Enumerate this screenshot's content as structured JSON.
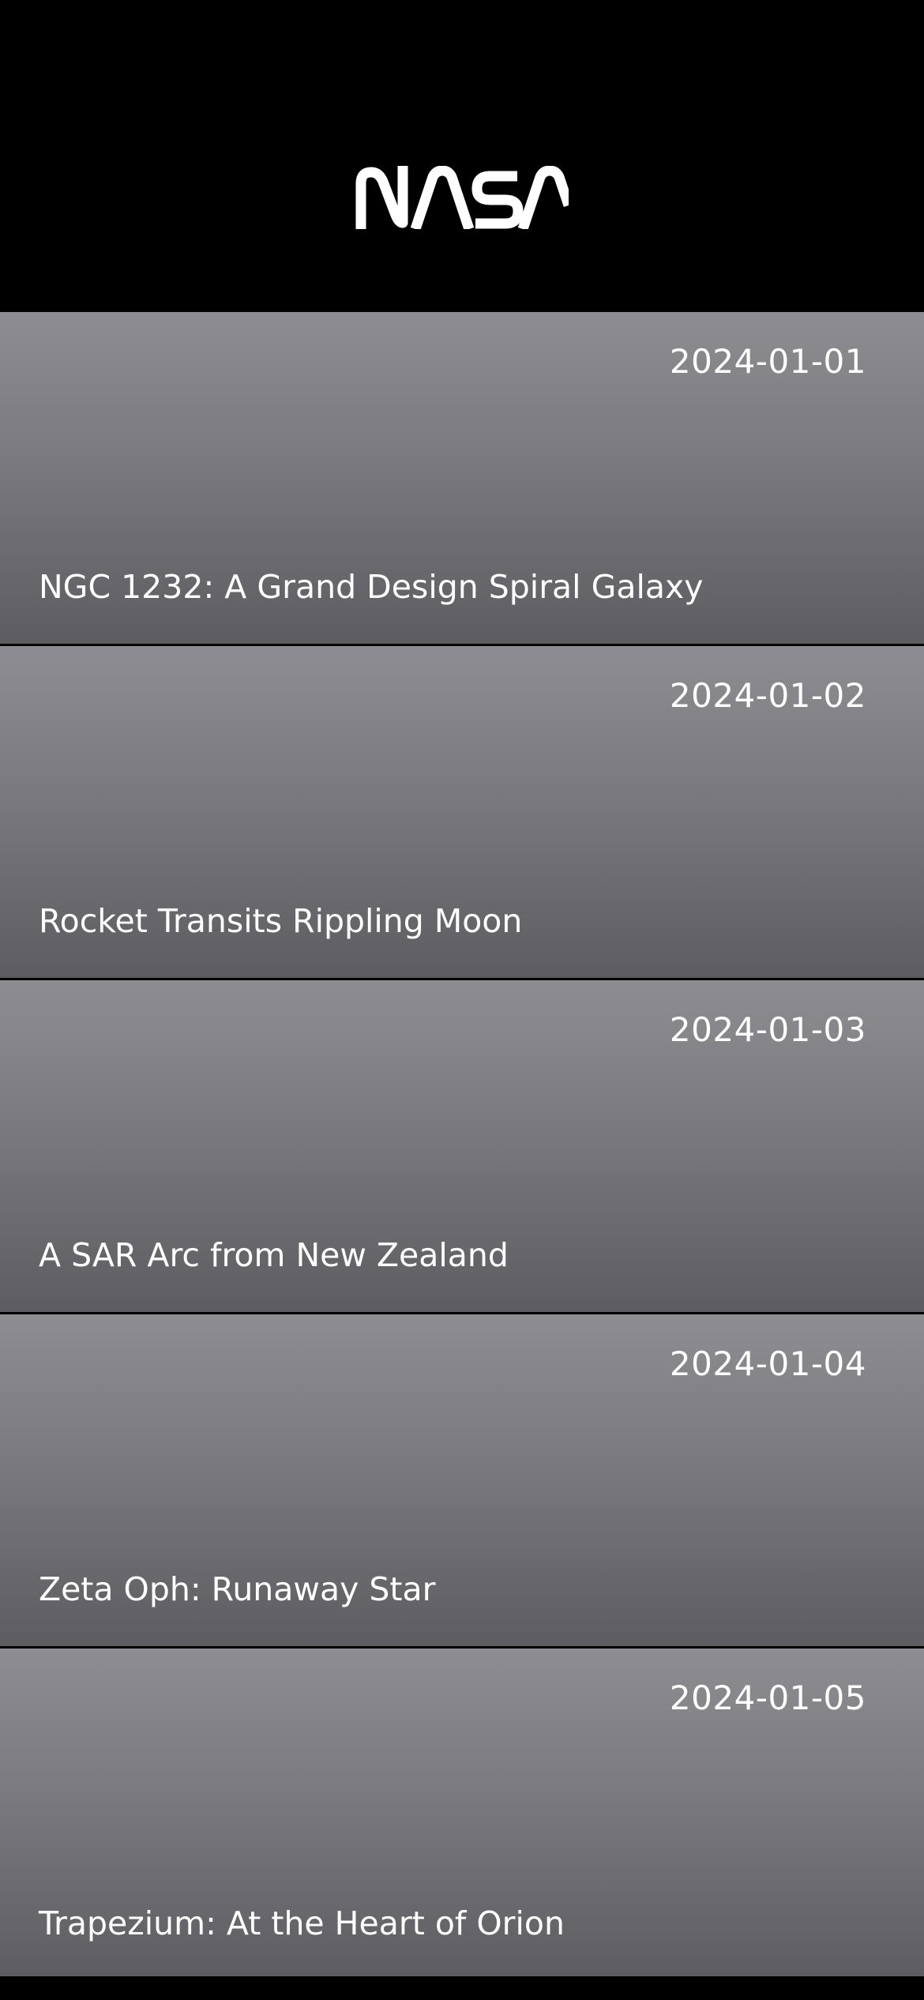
{
  "header": {
    "logo_text": "NASA",
    "logo_icon": "nasa-worm-logo"
  },
  "colors": {
    "background": "#000000",
    "card_top": "#8e8d92",
    "card_bottom": "#5d5d61",
    "text": "#ffffff",
    "divider": "#d4d4d6"
  },
  "items": [
    {
      "date": "2024-01-01",
      "title": "NGC 1232: A Grand Design Spiral Galaxy"
    },
    {
      "date": "2024-01-02",
      "title": "Rocket Transits Rippling Moon"
    },
    {
      "date": "2024-01-03",
      "title": "A SAR Arc from New Zealand"
    },
    {
      "date": "2024-01-04",
      "title": "Zeta Oph: Runaway Star"
    },
    {
      "date": "2024-01-05",
      "title": "Trapezium: At the Heart of Orion"
    }
  ]
}
